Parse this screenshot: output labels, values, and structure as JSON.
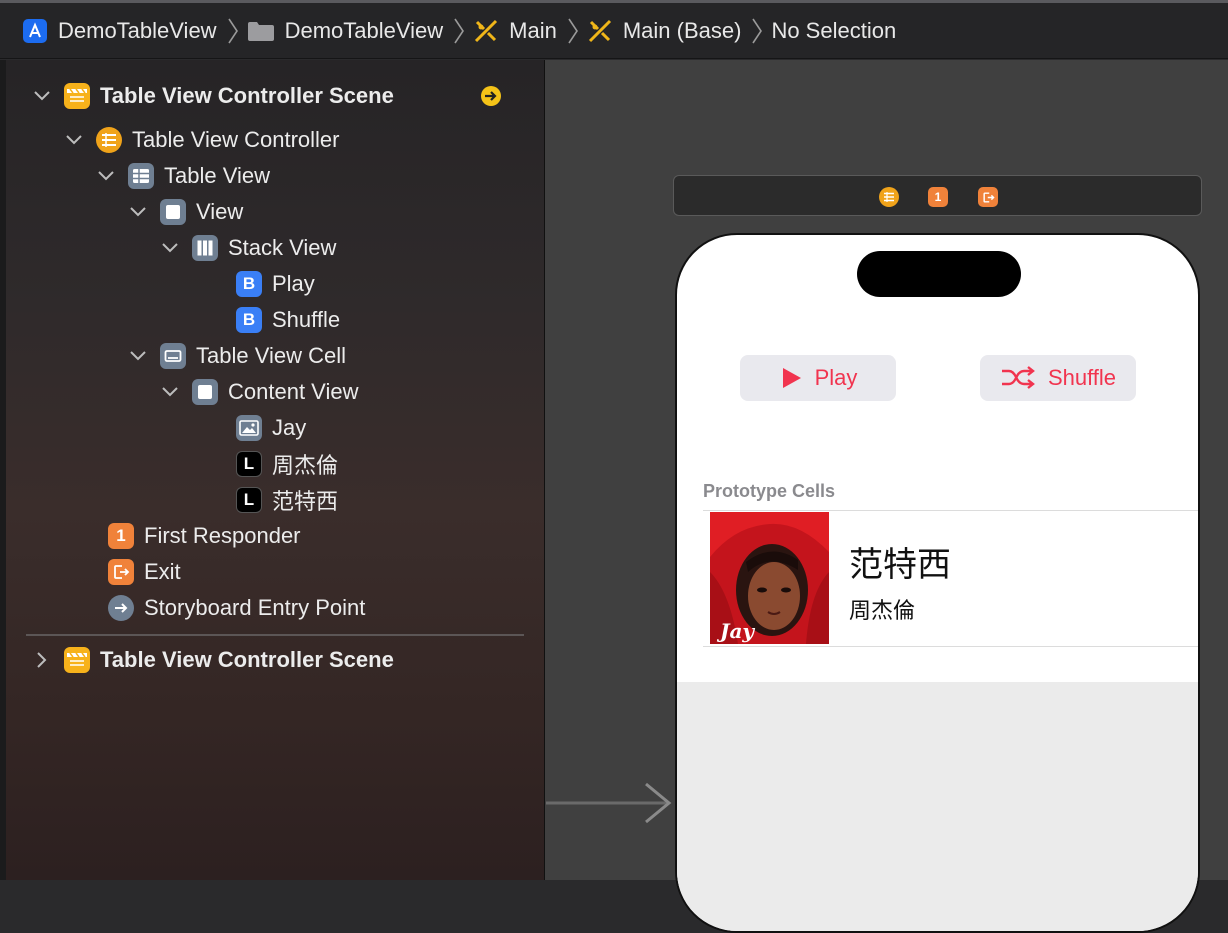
{
  "breadcrumb": [
    {
      "label": "DemoTableView",
      "icon": "xcode-project-icon"
    },
    {
      "label": "DemoTableView",
      "icon": "folder-icon"
    },
    {
      "label": "Main",
      "icon": "storyboard-icon"
    },
    {
      "label": "Main (Base)",
      "icon": "storyboard-icon"
    },
    {
      "label": "No Selection",
      "icon": ""
    }
  ],
  "outline": {
    "scene1": {
      "label": "Table View Controller Scene",
      "icon": "scene-icon",
      "accessory": "arrow-circle-icon"
    },
    "items": [
      {
        "label": "Table View Controller",
        "icon": "table-view-controller-icon",
        "badge": ""
      },
      {
        "label": "Table View",
        "icon": "table-view-icon",
        "badge": ""
      },
      {
        "label": "View",
        "icon": "view-icon",
        "badge": ""
      },
      {
        "label": "Stack View",
        "icon": "stack-view-icon",
        "badge": ""
      },
      {
        "label": "Play",
        "icon": "button-icon",
        "badge": "B"
      },
      {
        "label": "Shuffle",
        "icon": "button-icon",
        "badge": "B"
      },
      {
        "label": "Table View Cell",
        "icon": "table-view-cell-icon",
        "badge": ""
      },
      {
        "label": "Content View",
        "icon": "view-icon",
        "badge": ""
      },
      {
        "label": "Jay",
        "icon": "image-view-icon",
        "badge": ""
      },
      {
        "label": "周杰倫",
        "icon": "label-icon",
        "badge": "L"
      },
      {
        "label": "范特西",
        "icon": "label-icon",
        "badge": "L"
      },
      {
        "label": "First Responder",
        "icon": "first-responder-icon",
        "badge": "1"
      },
      {
        "label": "Exit",
        "icon": "exit-icon",
        "badge": ""
      },
      {
        "label": "Storyboard Entry Point",
        "icon": "entry-point-icon",
        "badge": ""
      }
    ],
    "scene2": {
      "label": "Table View Controller Scene",
      "icon": "scene-icon"
    }
  },
  "canvas": {
    "scene_bar_icons": [
      "view-controller-icon",
      "first-responder-icon",
      "exit-icon"
    ],
    "scene_bar_badge": "1",
    "play_label": "Play",
    "shuffle_label": "Shuffle",
    "section_header": "Prototype Cells",
    "cell_title": "范特西",
    "cell_subtitle": "周杰倫",
    "accent_color": "#f1344f"
  }
}
